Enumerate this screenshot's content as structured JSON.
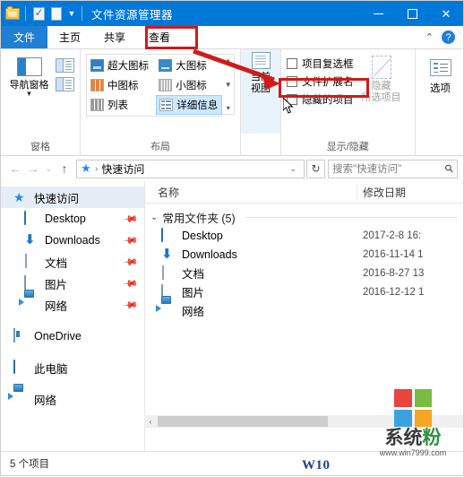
{
  "window": {
    "title": "文件资源管理器",
    "quick_access_icons": [
      "folder-icon",
      "properties-icon",
      "new-folder-icon",
      "customize-qat-chevron-icon"
    ],
    "controls": {
      "minimize": "—",
      "maximize": "□",
      "close": "✕"
    }
  },
  "ribbon": {
    "tabs": [
      {
        "label": "文件",
        "kind": "file"
      },
      {
        "label": "主页",
        "kind": "normal"
      },
      {
        "label": "共享",
        "kind": "normal"
      },
      {
        "label": "查看",
        "kind": "active"
      }
    ],
    "collapse_icon": "chevron-up-icon",
    "help_icon": "?",
    "groups": {
      "pane": {
        "label": "窗格",
        "navigation_pane": "导航窗格",
        "side_buttons": [
          "preview-pane-icon",
          "details-pane-icon"
        ]
      },
      "layout": {
        "label": "布局",
        "items": [
          {
            "label": "超大图标",
            "selected": false
          },
          {
            "label": "大图标",
            "selected": false
          },
          {
            "label": "中图标",
            "selected": false
          },
          {
            "label": "小图标",
            "selected": false
          },
          {
            "label": "列表",
            "selected": false
          },
          {
            "label": "详细信息",
            "selected": true
          }
        ],
        "scroll_up": "▲",
        "scroll_down": "▼",
        "expand": "▾"
      },
      "current_view": {
        "label": "当前视图",
        "button_line1": "当前",
        "button_line2": "视图",
        "caret": "▾"
      },
      "show_hide": {
        "label": "显示/隐藏",
        "checkboxes": [
          {
            "label": "项目复选框",
            "checked": false
          },
          {
            "label": "文件扩展名",
            "checked": false
          },
          {
            "label": "隐藏的项目",
            "checked": false
          }
        ],
        "hide_selected_line1": "隐藏",
        "hide_selected_line2": "所选项目",
        "hide_selected_disabled": true
      },
      "options": {
        "label": "选项"
      }
    }
  },
  "addressbar": {
    "back_icon": "←",
    "forward_icon": "→",
    "recent_icon": "⌄",
    "up_icon": "↑",
    "path_icon": "star-icon",
    "separator": "›",
    "path": "快速访问",
    "dropdown_icon": "⌄",
    "refresh_icon": "↻",
    "search_placeholder": "搜索\"快速访问\"",
    "search_value": "",
    "search_icon": "search-icon"
  },
  "navpane": {
    "items": [
      {
        "label": "快速访问",
        "icon": "star-icon",
        "selected": true,
        "child": false,
        "pinned": false
      },
      {
        "label": "Desktop",
        "icon": "desktop-icon",
        "selected": false,
        "child": true,
        "pinned": true
      },
      {
        "label": "Downloads",
        "icon": "downloads-icon",
        "selected": false,
        "child": true,
        "pinned": true
      },
      {
        "label": "文档",
        "icon": "documents-icon",
        "selected": false,
        "child": true,
        "pinned": true
      },
      {
        "label": "图片",
        "icon": "pictures-icon",
        "selected": false,
        "child": true,
        "pinned": true
      },
      {
        "label": "网络",
        "icon": "network-icon",
        "selected": false,
        "child": true,
        "pinned": true
      },
      {
        "label": "OneDrive",
        "icon": "onedrive-icon",
        "selected": false,
        "child": false,
        "pinned": false,
        "gap": true
      },
      {
        "label": "此电脑",
        "icon": "this-pc-icon",
        "selected": false,
        "child": false,
        "pinned": false,
        "gap": true
      },
      {
        "label": "网络",
        "icon": "network-icon",
        "selected": false,
        "child": false,
        "pinned": false,
        "gap": true
      }
    ],
    "pin_icon": "pin-icon"
  },
  "filelist": {
    "columns": {
      "name": "名称",
      "date": "修改日期"
    },
    "group": {
      "caret": "⌄",
      "label": "常用文件夹 (5)"
    },
    "rows": [
      {
        "name": "Desktop",
        "icon": "desktop-icon",
        "date": "2017-2-8 16:"
      },
      {
        "name": "Downloads",
        "icon": "downloads-icon",
        "date": "2016-11-14 1"
      },
      {
        "name": "文档",
        "icon": "documents-icon",
        "date": "2016-8-27 13"
      },
      {
        "name": "图片",
        "icon": "pictures-icon",
        "date": "2016-12-12 1"
      },
      {
        "name": "网络",
        "icon": "network-icon",
        "date": ""
      }
    ],
    "hscroll": {
      "left_icon": "‹",
      "right_icon": "›"
    }
  },
  "statusbar": {
    "item_count": "5 个项目"
  },
  "annotations": {
    "watermark_text_1": "系统",
    "watermark_text_2": "粉",
    "watermark_url": "www.win7999.com",
    "watermark_colors": [
      "#e8453c",
      "#7cbb42",
      "#3aa3dc",
      "#f6a623"
    ],
    "corner_mark": "W10",
    "highlight_color": "#d11a1a",
    "cursor": "arrow-cursor"
  }
}
